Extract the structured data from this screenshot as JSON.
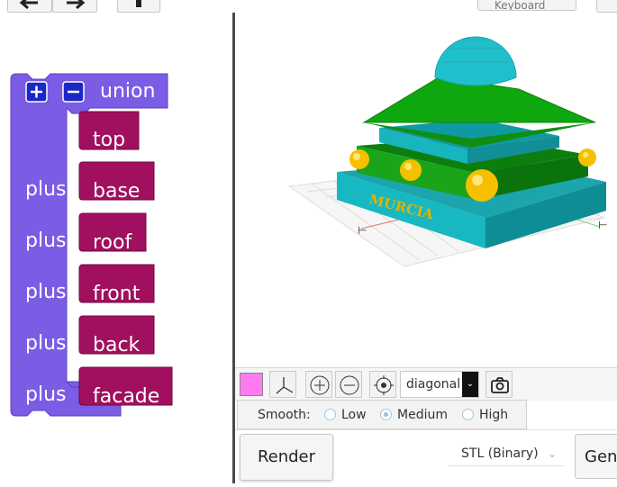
{
  "toolbar": {
    "undo_icon": "undo-arrow-icon",
    "redo_icon": "redo-arrow-icon",
    "delete_icon": "trash-icon",
    "keyboard_label": "Keyboard"
  },
  "blocks": {
    "operation": "union",
    "plus_label": "plus",
    "expand_icon": "plus-square-icon",
    "collapse_icon": "minus-square-icon",
    "first_item": "top",
    "items": [
      "base",
      "roof",
      "front",
      "back",
      "facade"
    ],
    "colors": {
      "union": "#7b5ce5",
      "variable": "#a0105e"
    }
  },
  "scene": {
    "model_label": "MURCIA",
    "colors": {
      "dome": "#1fc0cc",
      "roof": "#0fa10f",
      "base": "#14b4bd",
      "spheres": "#f5c000"
    }
  },
  "viewbar": {
    "swatch_color": "#ff7cf0",
    "view_value": "diagonal",
    "icons": [
      "axes-icon",
      "zoom-in-icon",
      "zoom-out-icon",
      "center-target-icon",
      "camera-icon"
    ]
  },
  "smooth": {
    "label": "Smooth:",
    "options": [
      "Low",
      "Medium",
      "High"
    ],
    "selected": "Medium"
  },
  "bottom": {
    "render_label": "Render",
    "format_value": "STL (Binary)",
    "generate_label": "Generate"
  }
}
